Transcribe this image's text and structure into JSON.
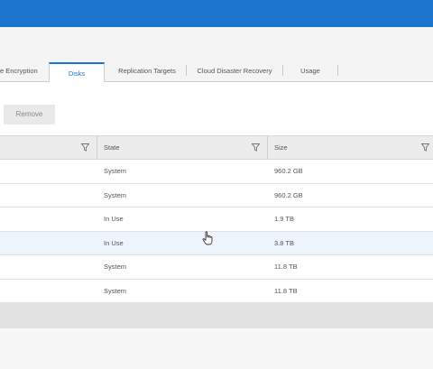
{
  "tabs": [
    {
      "label": "e Encryption"
    },
    {
      "label": "Disks"
    },
    {
      "label": "Replication Targets"
    },
    {
      "label": "Cloud Disaster Recovery"
    },
    {
      "label": "Usage"
    }
  ],
  "toolbar": {
    "remove_label": "Remove"
  },
  "table": {
    "columns": [
      "State",
      "Size"
    ],
    "rows": [
      {
        "state": "System",
        "size": "960.2 GB"
      },
      {
        "state": "System",
        "size": "960.2 GB"
      },
      {
        "state": "In Use",
        "size": "1.9 TB"
      },
      {
        "state": "In Use",
        "size": "3.8 TB"
      },
      {
        "state": "System",
        "size": "11.8 TB"
      },
      {
        "state": "System",
        "size": "11.8 TB"
      }
    ]
  },
  "icons": {
    "filter": "filter-icon",
    "cursor": "hand-pointer-icon"
  },
  "colors": {
    "accent": "#1c74cf"
  }
}
